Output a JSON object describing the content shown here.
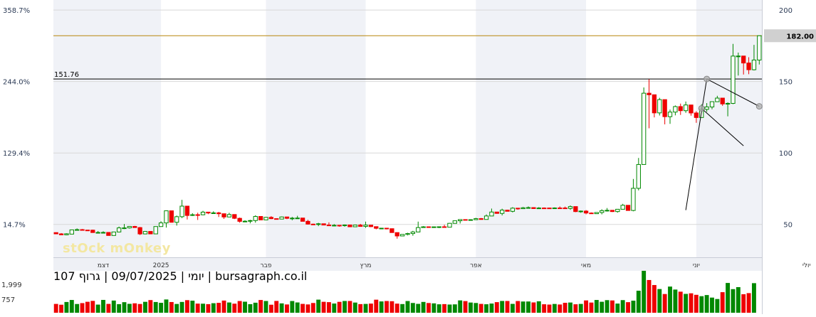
{
  "chart_data": {
    "type": "candlestick",
    "title": "יומי | 09/07/2025 | גרוף 107 | bursagraph.co.il",
    "watermark": "stOck mOnkey",
    "price_axis_right": {
      "ticks": [
        50,
        100,
        150,
        200
      ],
      "labels": [
        "50",
        "100",
        "150",
        "200"
      ],
      "ylim": [
        27,
        207
      ]
    },
    "percent_axis_left": {
      "labels": [
        "14.7%",
        "129.4%",
        "244.0%",
        "358.7%"
      ],
      "values_at_price": [
        50,
        100,
        150,
        200
      ]
    },
    "x_axis_labels": [
      {
        "label": "דצמ",
        "index": 9
      },
      {
        "label": "2025",
        "index": 20
      },
      {
        "label": "פבר",
        "index": 40
      },
      {
        "label": "מרץ",
        "index": 59
      },
      {
        "label": "אפר",
        "index": 80
      },
      {
        "label": "מאי",
        "index": 101
      },
      {
        "label": "יוני",
        "index": 122
      },
      {
        "label": "יולי",
        "index": 143
      }
    ],
    "last_price": {
      "value": 182.0,
      "label": "182.00",
      "color": "#b8860b"
    },
    "reference_line": {
      "value": 151.76,
      "label": "151.76"
    },
    "volume_axis": {
      "labels": [
        "1,999",
        "757"
      ]
    },
    "colors": {
      "up": "#008800",
      "down": "#ee0000",
      "band": "#f0f2f7",
      "grid": "#d8d8d8",
      "axis_text": "#333333"
    },
    "candles": [
      [
        44.28,
        44.33,
        43.4,
        43.4
      ],
      [
        43.39,
        43.94,
        42.73,
        42.73
      ],
      [
        42.73,
        43.83,
        42.48,
        43.47
      ],
      [
        43.23,
        46.18,
        43.23,
        46.18
      ],
      [
        46.18,
        47.2,
        45.8,
        46.37
      ],
      [
        46.37,
        46.8,
        45.98,
        46.04
      ],
      [
        46.04,
        46.04,
        45.88,
        46.0
      ],
      [
        46.0,
        46.33,
        44.27,
        44.32
      ],
      [
        44.32,
        45.4,
        44.0,
        44.38
      ],
      [
        44.38,
        45.2,
        44.1,
        44.4
      ],
      [
        44.4,
        44.4,
        42.26,
        42.26
      ],
      [
        42.26,
        44.71,
        42.26,
        44.71
      ],
      [
        44.71,
        48.51,
        44.37,
        47.55
      ],
      [
        47.55,
        50.28,
        46.76,
        47.58
      ],
      [
        47.58,
        48.8,
        47.1,
        48.6
      ],
      [
        48.6,
        49.0,
        47.71,
        47.8
      ],
      [
        47.8,
        48.2,
        42.57,
        43.35
      ],
      [
        43.35,
        45.43,
        43.1,
        45.1
      ],
      [
        45.1,
        45.1,
        43.38,
        43.38
      ],
      [
        43.38,
        48.67,
        43.15,
        48.52
      ],
      [
        48.52,
        52.25,
        48.5,
        51.05
      ],
      [
        51.05,
        59.72,
        47.8,
        59.53
      ],
      [
        59.53,
        59.53,
        51.29,
        51.49
      ],
      [
        51.49,
        56.2,
        49.2,
        55.41
      ],
      [
        55.41,
        67.18,
        54.4,
        62.8
      ],
      [
        62.8,
        62.8,
        53.44,
        56.27
      ],
      [
        56.27,
        57.83,
        55.9,
        56.8
      ],
      [
        56.8,
        58.18,
        53.13,
        56.74
      ],
      [
        56.74,
        59.52,
        56.46,
        58.6
      ],
      [
        58.6,
        58.6,
        57.2,
        57.98
      ],
      [
        57.98,
        59.2,
        57.5,
        58.1
      ],
      [
        58.1,
        58.79,
        55.2,
        57.48
      ],
      [
        57.48,
        57.48,
        53.85,
        55.2
      ],
      [
        55.2,
        58.12,
        55.2,
        56.93
      ],
      [
        56.93,
        56.93,
        53.73,
        54.27
      ],
      [
        54.27,
        54.8,
        51.2,
        52.15
      ],
      [
        52.15,
        52.94,
        51.97,
        52.26
      ],
      [
        52.26,
        53.24,
        50.76,
        52.71
      ],
      [
        52.71,
        56.39,
        51.24,
        55.57
      ],
      [
        55.57,
        55.57,
        53.07,
        53.15
      ],
      [
        53.15,
        55.23,
        53.04,
        54.95
      ],
      [
        54.95,
        55.8,
        53.71,
        54.03
      ],
      [
        54.03,
        54.03,
        53.5,
        53.75
      ],
      [
        53.75,
        55.54,
        53.75,
        55.23
      ],
      [
        55.23,
        55.23,
        53.67,
        54.27
      ],
      [
        54.27,
        55.27,
        52.93,
        54.41
      ],
      [
        54.41,
        56.02,
        53.84,
        54.47
      ],
      [
        54.47,
        54.47,
        52.17,
        52.17
      ],
      [
        52.17,
        53.22,
        49.89,
        50.21
      ],
      [
        50.21,
        50.52,
        50.01,
        50.02
      ],
      [
        50.02,
        51.09,
        48.81,
        50.47
      ],
      [
        50.47,
        50.47,
        49.54,
        49.57
      ],
      [
        49.57,
        51.44,
        48.97,
        49.18
      ],
      [
        49.18,
        50.21,
        48.62,
        49.41
      ],
      [
        49.41,
        49.41,
        48.4,
        49.19
      ],
      [
        49.19,
        49.95,
        48.41,
        49.61
      ],
      [
        49.61,
        49.61,
        48.27,
        48.35
      ],
      [
        48.35,
        49.75,
        48.25,
        49.55
      ],
      [
        49.55,
        50.36,
        48.58,
        48.6
      ],
      [
        48.6,
        51.97,
        47.56,
        49.5
      ],
      [
        49.5,
        49.5,
        48.08,
        48.45
      ],
      [
        48.45,
        48.47,
        46.56,
        47.3
      ],
      [
        47.3,
        47.38,
        46.99,
        47.37
      ],
      [
        47.37,
        47.58,
        46.52,
        47.02
      ],
      [
        47.02,
        47.02,
        44.3,
        44.3
      ],
      [
        44.3,
        44.3,
        40.03,
        41.92
      ],
      [
        41.92,
        43.02,
        41.92,
        43.0
      ],
      [
        43.0,
        44.13,
        42.36,
        43.62
      ],
      [
        43.62,
        45.52,
        42.09,
        44.71
      ],
      [
        44.71,
        51.96,
        44.71,
        47.8
      ],
      [
        47.8,
        48.82,
        47.8,
        48.35
      ],
      [
        48.35,
        48.54,
        47.75,
        48.03
      ],
      [
        48.03,
        48.31,
        47.92,
        48.31
      ],
      [
        48.31,
        48.39,
        47.47,
        48.37
      ],
      [
        48.37,
        49.74,
        48.02,
        48.06
      ],
      [
        48.06,
        50.99,
        48.06,
        50.77
      ],
      [
        50.77,
        52.61,
        50.59,
        52.55
      ],
      [
        52.55,
        53.44,
        50.67,
        53.39
      ],
      [
        53.39,
        53.39,
        52.95,
        53.15
      ],
      [
        53.15,
        53.64,
        52.98,
        53.31
      ],
      [
        53.31,
        54.6,
        53.31,
        54.05
      ],
      [
        54.05,
        54.49,
        53.32,
        53.48
      ],
      [
        53.48,
        56.99,
        53.44,
        55.9
      ],
      [
        55.9,
        61.1,
        55.9,
        58.68
      ],
      [
        58.68,
        58.68,
        57.45,
        57.71
      ],
      [
        57.71,
        61.0,
        56.29,
        59.99
      ],
      [
        59.99,
        60.24,
        59.08,
        59.17
      ],
      [
        59.17,
        62.06,
        58.42,
        61.36
      ],
      [
        61.36,
        61.47,
        60.27,
        61.01
      ],
      [
        61.01,
        62.25,
        60.81,
        61.66
      ],
      [
        61.66,
        62.58,
        61.32,
        61.77
      ],
      [
        61.77,
        61.95,
        60.87,
        61.09
      ],
      [
        61.09,
        62.09,
        60.85,
        61.49
      ],
      [
        61.49,
        61.9,
        61.1,
        61.48
      ],
      [
        61.48,
        61.7,
        61.1,
        61.38
      ],
      [
        61.38,
        61.92,
        61.07,
        61.52
      ],
      [
        61.52,
        62.57,
        61.3,
        61.51
      ],
      [
        61.51,
        62.47,
        60.98,
        61.21
      ],
      [
        61.21,
        63.27,
        60.23,
        62.48
      ],
      [
        62.48,
        62.48,
        58.6,
        58.98
      ],
      [
        58.98,
        59.76,
        58.15,
        59.34
      ],
      [
        59.34,
        60.02,
        57.06,
        57.98
      ],
      [
        57.98,
        58.39,
        57.33,
        57.5
      ],
      [
        57.5,
        58.51,
        57.42,
        58.34
      ],
      [
        58.34,
        60.62,
        57.04,
        59.63
      ],
      [
        59.63,
        61.47,
        59.0,
        59.88
      ],
      [
        59.88,
        59.88,
        58.69,
        58.99
      ],
      [
        58.99,
        60.7,
        58.25,
        60.61
      ],
      [
        60.61,
        64.4,
        60.61,
        63.39
      ],
      [
        63.39,
        63.39,
        59.56,
        59.76
      ],
      [
        59.76,
        81.81,
        59.2,
        75.26
      ],
      [
        75.26,
        96.5,
        73.8,
        91.92
      ],
      [
        91.92,
        145.81,
        91.92,
        141.8
      ],
      [
        141.8,
        151.57,
        117.25,
        140.71
      ],
      [
        140.71,
        140.71,
        124.87,
        128.03
      ],
      [
        128.03,
        138.57,
        126.19,
        137.31
      ],
      [
        137.31,
        137.31,
        120.0,
        125.38
      ],
      [
        125.38,
        130.35,
        120.36,
        128.59
      ],
      [
        128.59,
        133.22,
        126.31,
        132.44
      ],
      [
        132.44,
        134.52,
        126.61,
        129.57
      ],
      [
        129.57,
        135.97,
        128.08,
        133.57
      ],
      [
        133.57,
        133.57,
        126.08,
        127.97
      ],
      [
        127.97,
        129.2,
        121.09,
        124.78
      ],
      [
        124.78,
        134.03,
        124.78,
        130.53
      ],
      [
        130.53,
        134.87,
        128.77,
        132.18
      ],
      [
        132.18,
        135.98,
        130.55,
        135.85
      ],
      [
        135.85,
        139.97,
        135.85,
        138.37
      ],
      [
        138.37,
        138.37,
        132.95,
        134.3
      ],
      [
        134.3,
        135.42,
        125.62,
        134.67
      ],
      [
        134.67,
        176.3,
        134.16,
        167.77
      ],
      [
        167.77,
        170.2,
        154.16,
        167.81
      ],
      [
        167.81,
        167.81,
        154.87,
        162.93
      ],
      [
        162.93,
        166.98,
        155.1,
        158.22
      ],
      [
        158.22,
        175.61,
        157.72,
        165.0
      ],
      [
        165.0,
        182.0,
        161.89,
        182.0
      ]
    ],
    "pattern_points": [
      {
        "index": 124,
        "price": 151.76
      },
      {
        "index": 123,
        "price": 131.2
      },
      {
        "index": 134,
        "price": 132.6
      }
    ],
    "volume_thousands": [
      420,
      382,
      512,
      608,
      416,
      459,
      522,
      565,
      388,
      611,
      421,
      580,
      410,
      503,
      424,
      449,
      417,
      520,
      603,
      511,
      473,
      632,
      510,
      418,
      514,
      599,
      575,
      435,
      431,
      410,
      454,
      471,
      580,
      489,
      432,
      558,
      526,
      409,
      478,
      607,
      560,
      382,
      562,
      446,
      395,
      558,
      490,
      421,
      396,
      464,
      624,
      521,
      505,
      439,
      519,
      560,
      560,
      485,
      411,
      420,
      436,
      622,
      539,
      558,
      549,
      434,
      413,
      558,
      465,
      423,
      515,
      463,
      447,
      402,
      411,
      391,
      399,
      588,
      555,
      486,
      464,
      421,
      404,
      438,
      505,
      561,
      560,
      422,
      558,
      535,
      536,
      491,
      545,
      404,
      389,
      418,
      393,
      473,
      487,
      403,
      420,
      587,
      485,
      608,
      523,
      600,
      586,
      437,
      601,
      504,
      576,
      1050,
      1999,
      1560,
      1320,
      1130,
      892,
      1247,
      1105,
      1004,
      898,
      926,
      854,
      789,
      843,
      722,
      654,
      980,
      1420,
      1125,
      1220,
      882,
      935,
      1410
    ]
  }
}
